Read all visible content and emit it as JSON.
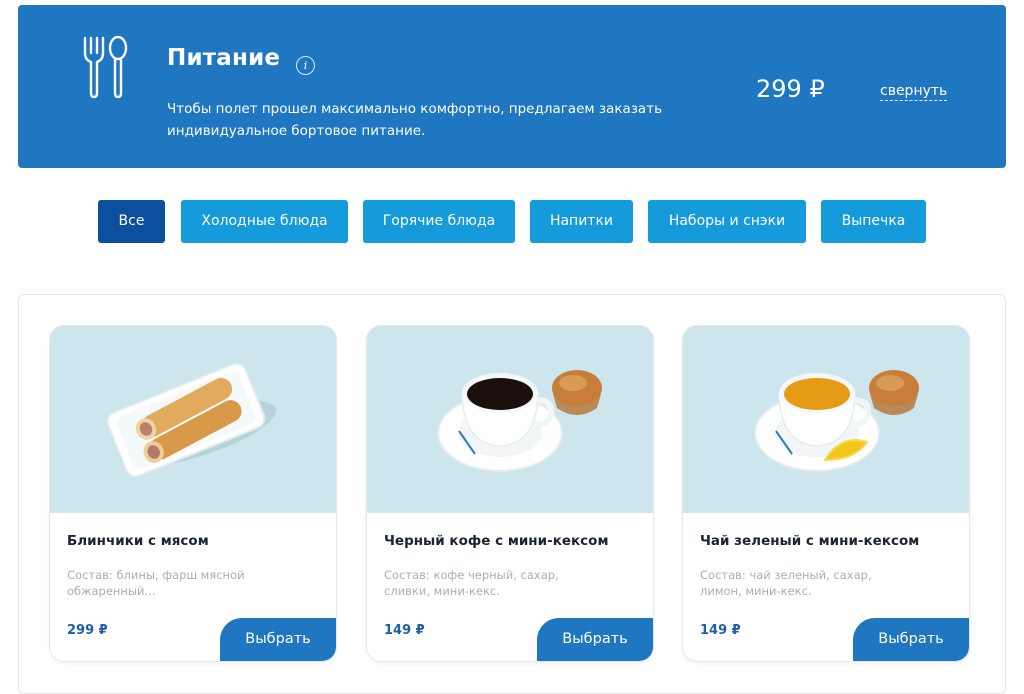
{
  "banner": {
    "title": "Питание",
    "info_icon": "i",
    "description": "Чтобы полет прошел максимально комфортно, предлагаем заказать индивидуальное бортовое питание.",
    "price": "299 ₽",
    "collapse_label": "свернуть",
    "color": "#1f76c1"
  },
  "filters": [
    {
      "label": "Все",
      "active": true
    },
    {
      "label": "Холодные блюда",
      "active": false
    },
    {
      "label": "Горячие блюда",
      "active": false
    },
    {
      "label": "Напитки",
      "active": false
    },
    {
      "label": "Наборы и снэки",
      "active": false
    },
    {
      "label": "Выпечка",
      "active": false
    }
  ],
  "items": [
    {
      "name": "Блинчики с мясом",
      "composition": "Состав: блины, фарш мясной обжаренный...",
      "price": "299 ₽",
      "button": "Выбрать",
      "image": "pancakes-photo"
    },
    {
      "name": "Черный кофе с мини-кексом",
      "composition": "Состав: кофе черный, сахар, сливки, мини-кекс.",
      "price": "149 ₽",
      "button": "Выбрать",
      "image": "coffee-photo"
    },
    {
      "name": "Чай зеленый с мини-кексом",
      "composition": "Состав: чай зеленый, сахар, лимон, мини-кекс.",
      "price": "149 ₽",
      "button": "Выбрать",
      "image": "tea-photo"
    }
  ]
}
